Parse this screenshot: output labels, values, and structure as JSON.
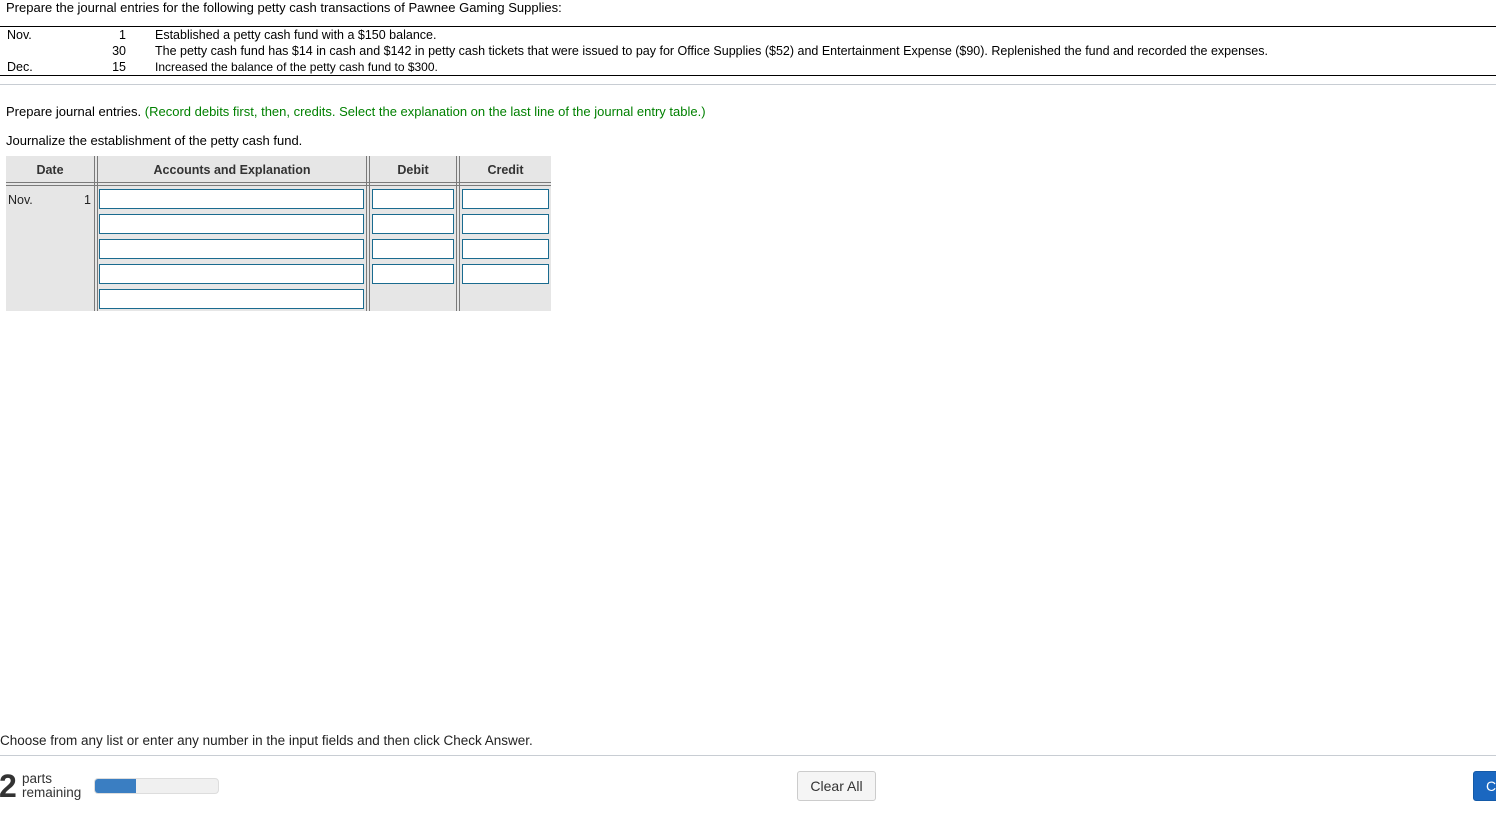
{
  "problem": {
    "intro": "Prepare the journal entries for the following petty cash transactions of Pawnee Gaming Supplies:",
    "transactions": [
      {
        "month": "Nov.",
        "day": "1",
        "description": "Established a petty cash fund with a $150 balance."
      },
      {
        "month": "",
        "day": "30",
        "description": "The petty cash fund has $14 in cash and $142 in petty cash tickets that were issued to pay for Office Supplies ($52) and Entertainment Expense ($90). Replenished the fund and recorded the expenses."
      },
      {
        "month": "Dec.",
        "day": "15",
        "description": "Increased the balance of the petty cash fund to $300."
      }
    ]
  },
  "instructions": {
    "main": "Prepare journal entries.",
    "hint": "(Record debits first, then, credits. Select the explanation on the last line of the journal entry table.)",
    "subtask": "Journalize the establishment of the petty cash fund."
  },
  "journal": {
    "headers": {
      "date": "Date",
      "accounts": "Accounts and Explanation",
      "debit": "Debit",
      "credit": "Credit"
    },
    "entry_date": {
      "month": "Nov.",
      "day": "1"
    },
    "rows": [
      {
        "account": "",
        "debit": "",
        "credit": ""
      },
      {
        "account": "",
        "debit": "",
        "credit": ""
      },
      {
        "account": "",
        "debit": "",
        "credit": ""
      },
      {
        "account": "",
        "debit": "",
        "credit": ""
      }
    ],
    "explanation": ""
  },
  "footer": {
    "message": "Choose from any list or enter any number in the input fields and then click Check Answer.",
    "parts_remaining_count": "2",
    "parts_remaining_label_1": "parts",
    "parts_remaining_label_2": "remaining",
    "progress_fraction": 0.33,
    "progress_color": "#3a7ec2",
    "clear_all_label": "Clear All",
    "check_answer_label": "Check Answer",
    "check_answer_visible_label": "C"
  }
}
